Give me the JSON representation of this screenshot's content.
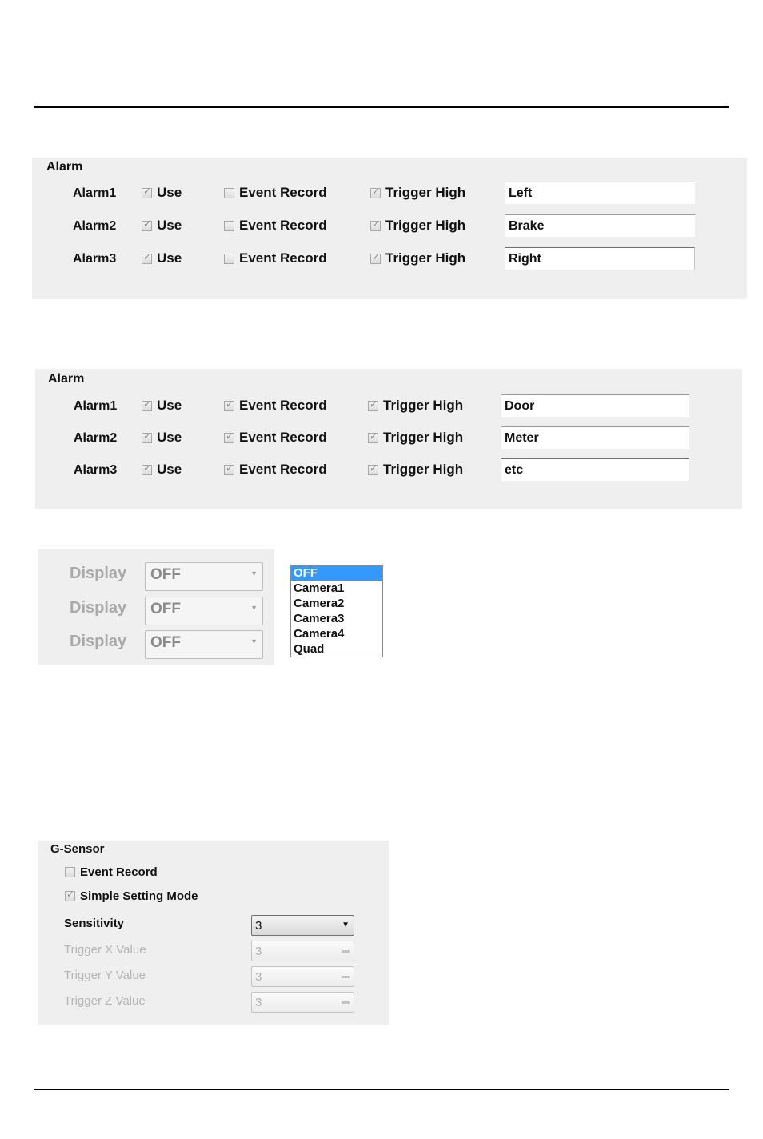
{
  "panel1": {
    "title": "Alarm",
    "rows": [
      {
        "label": "Alarm1",
        "use_label": "Use",
        "use_checked": true,
        "event_label": "Event Record",
        "event_checked": false,
        "trigger_label": "Trigger High",
        "trigger_checked": true,
        "name_value": "Left"
      },
      {
        "label": "Alarm2",
        "use_label": "Use",
        "use_checked": true,
        "event_label": "Event Record",
        "event_checked": false,
        "trigger_label": "Trigger High",
        "trigger_checked": true,
        "name_value": "Brake"
      },
      {
        "label": "Alarm3",
        "use_label": "Use",
        "use_checked": true,
        "event_label": "Event Record",
        "event_checked": false,
        "trigger_label": "Trigger High",
        "trigger_checked": true,
        "name_value": "Right"
      }
    ]
  },
  "panel2": {
    "title": "Alarm",
    "rows": [
      {
        "label": "Alarm1",
        "use_label": "Use",
        "use_checked": true,
        "event_label": "Event Record",
        "event_checked": true,
        "trigger_label": "Trigger High",
        "trigger_checked": true,
        "name_value": "Door"
      },
      {
        "label": "Alarm2",
        "use_label": "Use",
        "use_checked": true,
        "event_label": "Event Record",
        "event_checked": true,
        "trigger_label": "Trigger High",
        "trigger_checked": true,
        "name_value": "Meter"
      },
      {
        "label": "Alarm3",
        "use_label": "Use",
        "use_checked": true,
        "event_label": "Event Record",
        "event_checked": true,
        "trigger_label": "Trigger High",
        "trigger_checked": true,
        "name_value": "etc"
      }
    ]
  },
  "display": {
    "rows": [
      {
        "label": "Display",
        "value": "OFF"
      },
      {
        "label": "Display",
        "value": "OFF"
      },
      {
        "label": "Display",
        "value": "OFF"
      }
    ],
    "options": [
      "OFF",
      "Camera1",
      "Camera2",
      "Camera3",
      "Camera4",
      "Quad"
    ],
    "selected": "OFF"
  },
  "gsensor": {
    "title": "G-Sensor",
    "event_record_label": "Event Record",
    "event_record_checked": false,
    "simple_mode_label": "Simple Setting Mode",
    "simple_mode_checked": true,
    "sensitivity_label": "Sensitivity",
    "sensitivity_value": "3",
    "trigger_x_label": "Trigger X Value",
    "trigger_x_value": "3",
    "trigger_y_label": "Trigger Y Value",
    "trigger_y_value": "3",
    "trigger_z_label": "Trigger Z Value",
    "trigger_z_value": "3"
  }
}
